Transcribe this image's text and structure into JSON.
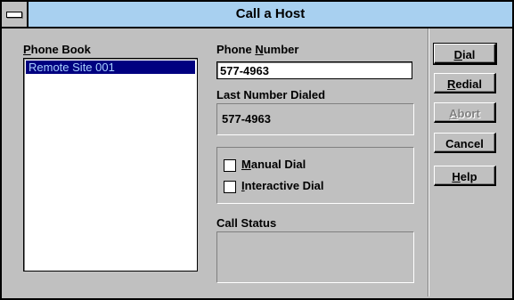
{
  "window": {
    "title": "Call a Host"
  },
  "phone_book": {
    "label": "Phone Book",
    "items": [
      "Remote Site 001"
    ]
  },
  "phone_number": {
    "label": "Phone Number",
    "value": "577-4963"
  },
  "last_number": {
    "label": "Last Number Dialed",
    "value": "577-4963"
  },
  "options": {
    "manual_dial": {
      "label": "Manual Dial",
      "checked": false
    },
    "interactive_dial": {
      "label": "Interactive Dial",
      "checked": false
    }
  },
  "call_status": {
    "label": "Call Status",
    "value": ""
  },
  "buttons": {
    "dial": "Dial",
    "redial": "Redial",
    "abort": "Abort",
    "cancel": "Cancel",
    "help": "Help"
  }
}
